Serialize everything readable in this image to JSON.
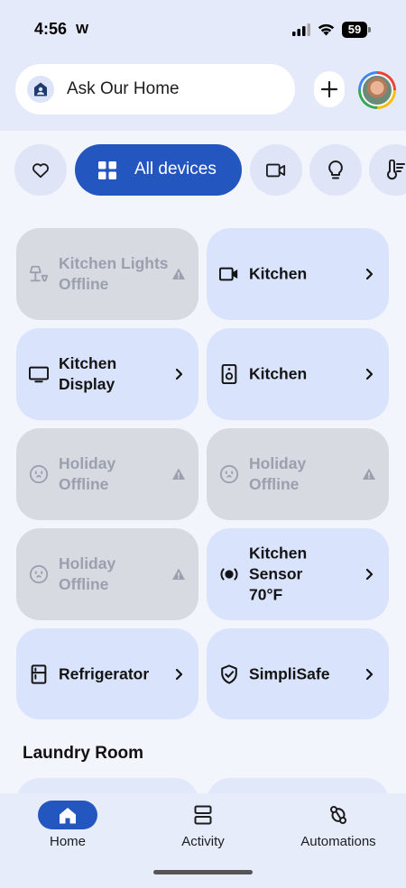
{
  "status_bar": {
    "time": "4:56",
    "carrier_glyph": "W",
    "battery": "59"
  },
  "header": {
    "ask_label": "Ask Our Home"
  },
  "filters": {
    "all_devices_label": "All devices",
    "chips": [
      "favorites-heart-icon",
      "all-devices-grid-icon",
      "camera-icon",
      "light-bulb-icon",
      "thermostat-icon"
    ]
  },
  "devices": [
    {
      "name": "Kitchen Lights",
      "status": "Offline",
      "icon": "lamp-icon",
      "offline": true
    },
    {
      "name": "Kitchen",
      "status": "",
      "icon": "camera-icon",
      "offline": false
    },
    {
      "name": "Kitchen",
      "status": "Display",
      "icon": "display-icon",
      "offline": false
    },
    {
      "name": "Kitchen",
      "status": "",
      "icon": "speaker-icon",
      "offline": false
    },
    {
      "name": "Holiday",
      "status": "Offline",
      "icon": "outlet-icon",
      "offline": true
    },
    {
      "name": "Holiday",
      "status": "Offline",
      "icon": "outlet-icon",
      "offline": true
    },
    {
      "name": "Holiday",
      "status": "Offline",
      "icon": "outlet-icon",
      "offline": true
    },
    {
      "name": "Kitchen",
      "status": "Sensor",
      "reading": "70°F",
      "icon": "sensor-icon",
      "offline": false
    },
    {
      "name": "Refrigerator",
      "status": "",
      "icon": "refrigerator-icon",
      "offline": false
    },
    {
      "name": "SimpliSafe",
      "status": "",
      "icon": "shield-icon",
      "offline": false
    }
  ],
  "section": {
    "title": "Laundry Room"
  },
  "nav": {
    "home": "Home",
    "activity": "Activity",
    "automations": "Automations"
  },
  "colors": {
    "accent": "#2356bf",
    "tile_online": "#d9e3fb",
    "tile_offline": "#d8dae2",
    "header_bg": "#e5eafb"
  }
}
